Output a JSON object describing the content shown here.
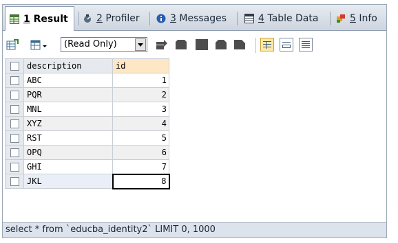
{
  "tabs": [
    {
      "num": "1",
      "label": "Result",
      "icon": "result-grid-icon",
      "active": true
    },
    {
      "num": "2",
      "label": "Profiler",
      "icon": "profiler-icon",
      "active": false
    },
    {
      "num": "3",
      "label": "Messages",
      "icon": "info-bubble-icon",
      "active": false
    },
    {
      "num": "4",
      "label": "Table Data",
      "icon": "table-icon",
      "active": false
    },
    {
      "num": "5",
      "label": "Info",
      "icon": "info-flag-icon",
      "active": false
    }
  ],
  "toolbar": {
    "mode_select": "(Read Only)",
    "icons": [
      "export-icon",
      "grid-options-icon",
      "add-row-icon",
      "duplicate-row-icon",
      "save-icon",
      "delete-row-icon",
      "cancel-icon",
      "grid-view-icon",
      "form-view-icon",
      "text-view-icon"
    ]
  },
  "grid": {
    "columns": [
      "description",
      "id"
    ],
    "rows": [
      {
        "description": "ABC",
        "id": "1"
      },
      {
        "description": "PQR",
        "id": "2"
      },
      {
        "description": "MNL",
        "id": "3"
      },
      {
        "description": "XYZ",
        "id": "4"
      },
      {
        "description": "RST",
        "id": "5"
      },
      {
        "description": "OPQ",
        "id": "6"
      },
      {
        "description": "GHI",
        "id": "7"
      },
      {
        "description": "JKL",
        "id": "8"
      }
    ]
  },
  "status": {
    "query": "select * from `educba_identity2` LIMIT 0, 1000"
  },
  "colors": {
    "tab_bar": "#cdd5df",
    "status_bar": "#dce3ec",
    "id_header": "#fde7c4",
    "active_view": "#ffe7a8"
  }
}
